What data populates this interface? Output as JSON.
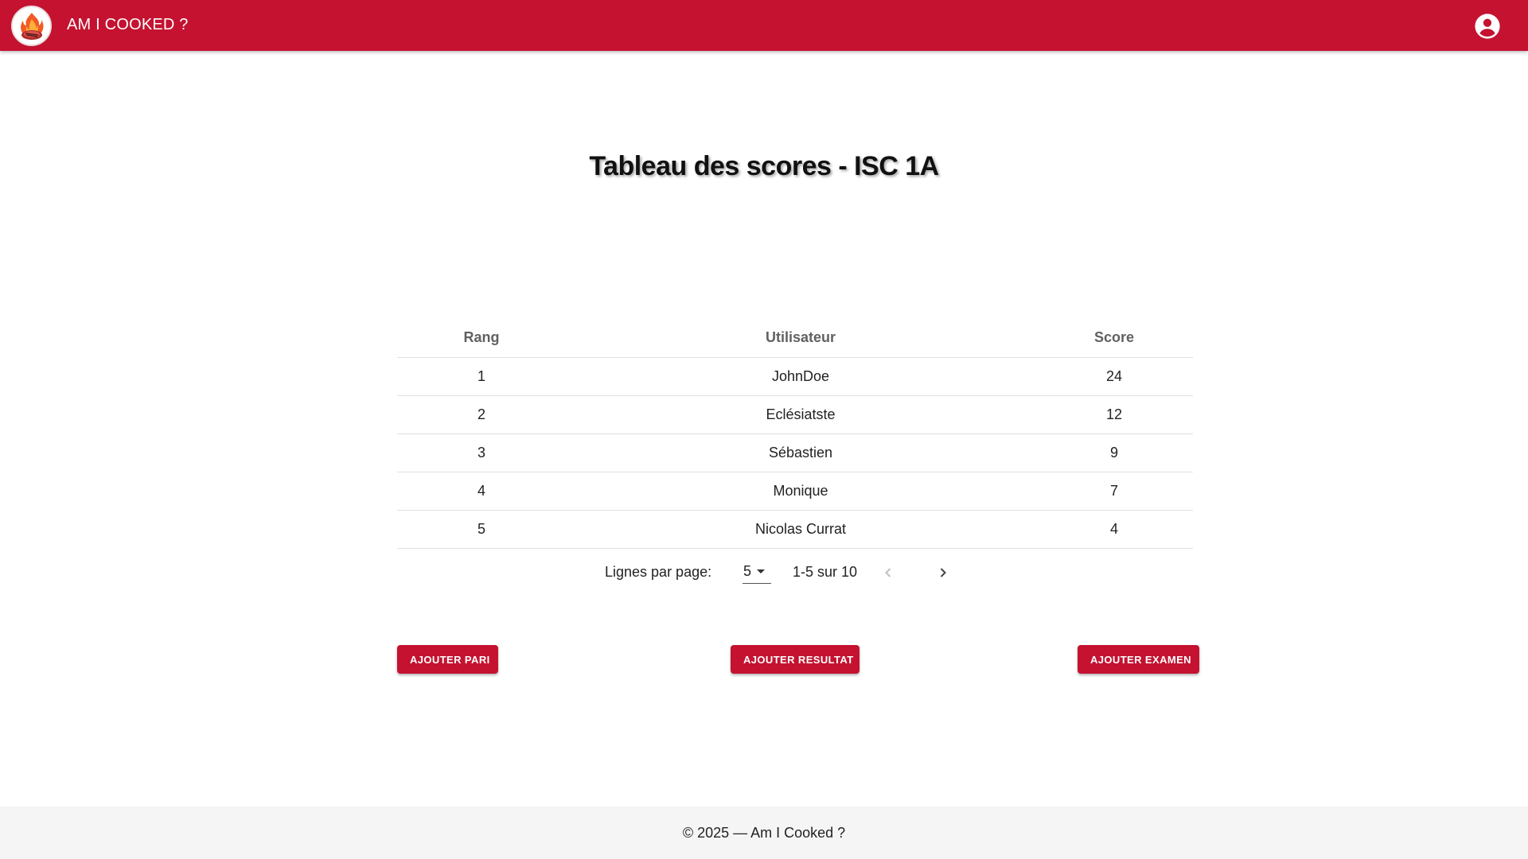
{
  "header": {
    "app_title": "AM I COOKED ?",
    "brand_color": "#c41230",
    "logo_icon": "flame-steak-icon",
    "account_icon": "account-circle-icon"
  },
  "main": {
    "title": "Tableau des scores - ISC 1A"
  },
  "table": {
    "columns": [
      "Rang",
      "Utilisateur",
      "Score"
    ],
    "rows": [
      {
        "rank": "1",
        "user": "JohnDoe",
        "score": "24"
      },
      {
        "rank": "2",
        "user": "Eclésiatste",
        "score": "12"
      },
      {
        "rank": "3",
        "user": "Sébastien",
        "score": "9"
      },
      {
        "rank": "4",
        "user": "Monique",
        "score": "7"
      },
      {
        "rank": "5",
        "user": "Nicolas Currat",
        "score": "4"
      }
    ]
  },
  "pagination": {
    "rows_label": "Lignes par page:",
    "rows_per_page": "5",
    "range_text": "1-5 sur 10",
    "prev_icon": "chevron-left-icon",
    "next_icon": "chevron-right-icon"
  },
  "actions": {
    "add_bet": "AJOUTER PARI",
    "add_result": "AJOUTER RESULTAT",
    "add_exam": "AJOUTER EXAMEN"
  },
  "footer": {
    "text": "© 2025 — Am I Cooked ?"
  }
}
